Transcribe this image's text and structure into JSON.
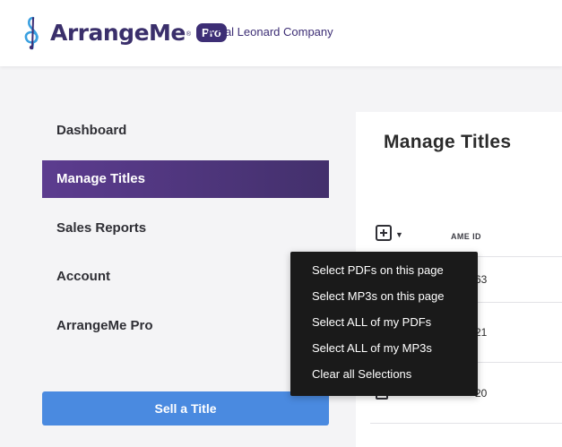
{
  "header": {
    "brand": "ArrangeMe",
    "brand_mark": "®",
    "badge": "Pro",
    "company": "A Hal Leonard Company",
    "logo_icon": "treble-clef-logo-icon"
  },
  "sidebar": {
    "items": [
      {
        "label": "Dashboard",
        "active": false
      },
      {
        "label": "Manage Titles",
        "active": true
      },
      {
        "label": "Sales Reports",
        "active": false
      },
      {
        "label": "Account",
        "active": false
      },
      {
        "label": "ArrangeMe Pro",
        "active": false
      }
    ],
    "sell_button": "Sell a Title"
  },
  "main": {
    "title": "Manage Titles",
    "table": {
      "columns": [
        "AME ID"
      ],
      "rows": [
        {
          "ame_id": "63"
        },
        {
          "ame_id": "21"
        },
        {
          "ame_id": "20"
        }
      ]
    }
  },
  "select_menu": {
    "items": [
      "Select PDFs on this page",
      "Select MP3s on this page",
      "Select ALL of my PDFs",
      "Select ALL of my MP3s",
      "Clear all Selections"
    ]
  },
  "colors": {
    "nav_active_start": "#5c3c8f",
    "nav_active_end": "#43306c",
    "sell_button": "#4a8ae0",
    "brand": "#3d2e75",
    "dropdown_bg": "#1a1a1a"
  }
}
